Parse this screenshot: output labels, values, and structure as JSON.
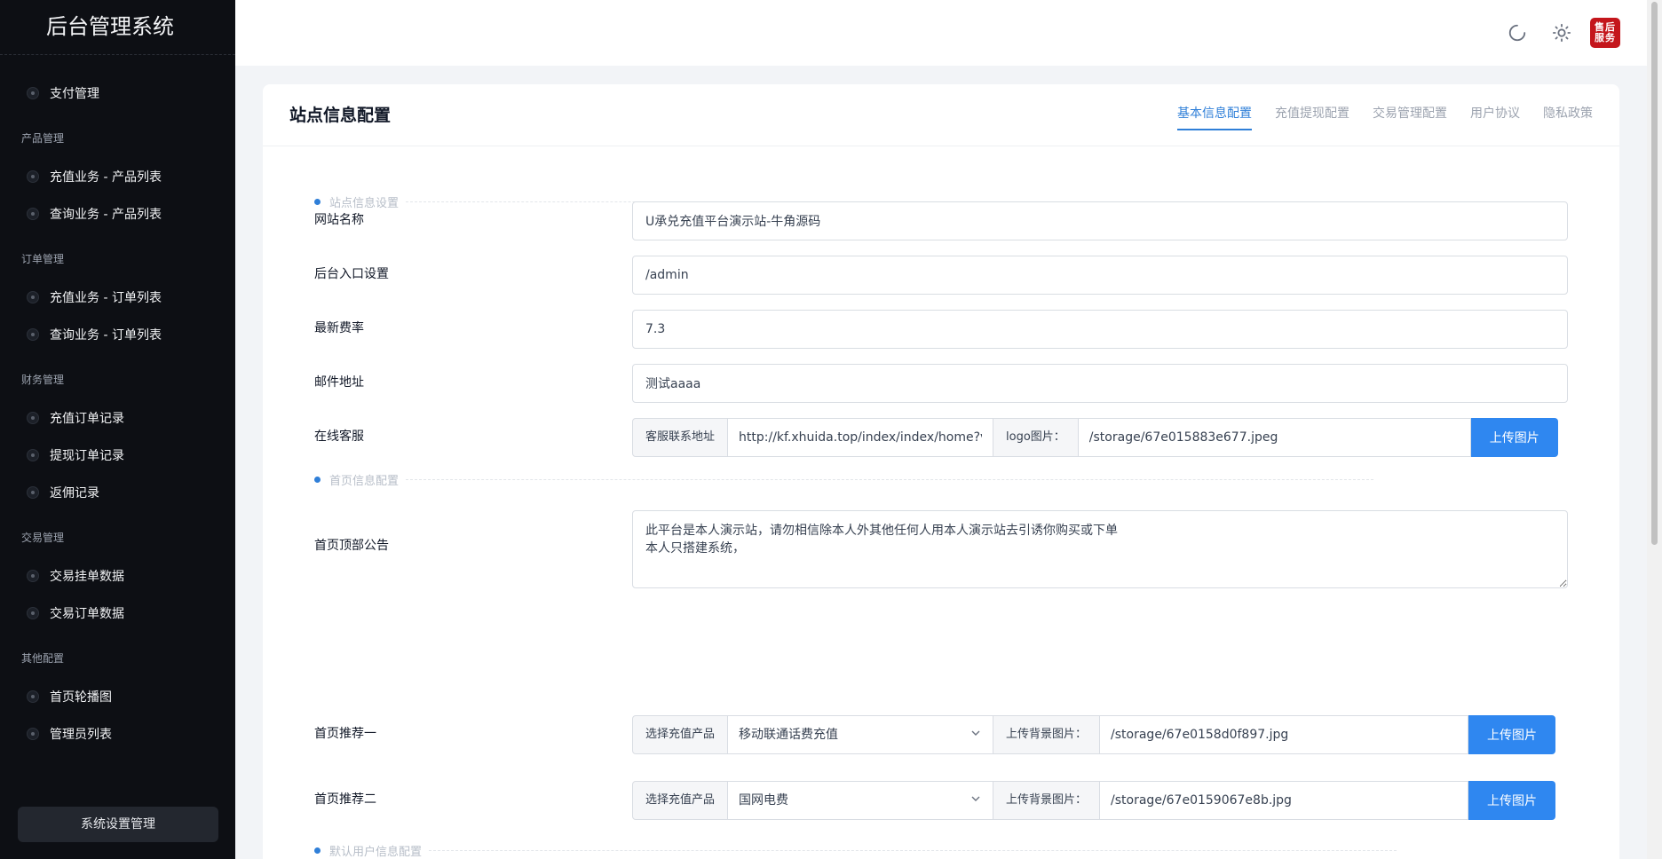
{
  "sidebar": {
    "brand": "后台管理系统",
    "items_top": [
      {
        "label": "支付管理"
      }
    ],
    "groups": [
      {
        "title": "产品管理",
        "items": [
          {
            "label": "充值业务 - 产品列表"
          },
          {
            "label": "查询业务 - 产品列表"
          }
        ]
      },
      {
        "title": "订单管理",
        "items": [
          {
            "label": "充值业务 - 订单列表"
          },
          {
            "label": "查询业务 - 订单列表"
          }
        ]
      },
      {
        "title": "财务管理",
        "items": [
          {
            "label": "充值订单记录"
          },
          {
            "label": "提现订单记录"
          },
          {
            "label": "返佣记录"
          }
        ]
      },
      {
        "title": "交易管理",
        "items": [
          {
            "label": "交易挂单数据"
          },
          {
            "label": "交易订单数据"
          }
        ]
      },
      {
        "title": "其他配置",
        "items": [
          {
            "label": "首页轮播图"
          },
          {
            "label": "管理员列表"
          }
        ]
      }
    ],
    "system_button": "系统设置管理"
  },
  "header": {
    "support_badge": "售后服务",
    "icons": [
      "refresh-icon",
      "sun-icon"
    ]
  },
  "card": {
    "title": "站点信息配置",
    "tabs": [
      {
        "label": "基本信息配置",
        "active": true
      },
      {
        "label": "充值提现配置",
        "active": false
      },
      {
        "label": "交易管理配置",
        "active": false
      },
      {
        "label": "用户协议",
        "active": false
      },
      {
        "label": "隐私政策",
        "active": false
      }
    ]
  },
  "sections": {
    "site": "站点信息设置",
    "home": "首页信息配置",
    "default_user": "默认用户信息配置"
  },
  "form": {
    "site_name": {
      "label": "网站名称",
      "value": "U承兑充值平台演示站-牛角源码"
    },
    "admin_entry": {
      "label": "后台入口设置",
      "value": "/admin"
    },
    "rate": {
      "label": "最新费率",
      "value": "7.3"
    },
    "email": {
      "label": "邮件地址",
      "value": "测试aaaa"
    },
    "online_service": {
      "label": "在线客服",
      "contact_addon": "客服联系地址",
      "contact_value": "http://kf.xhuida.top/index/index/home?v",
      "logo_addon": "logo图片：",
      "logo_value": "/storage/67e015883e677.jpeg",
      "upload_label": "上传图片"
    },
    "notice": {
      "label": "首页顶部公告",
      "value": "此平台是本人演示站，请勿相信除本人外其他任何人用本人演示站去引诱你购买或下单\n本人只搭建系统，"
    },
    "recommend1": {
      "label": "首页推荐一",
      "product_addon": "选择充值产品",
      "product_value": "移动联通话费充值",
      "bg_addon": "上传背景图片：",
      "bg_value": "/storage/67e0158d0f897.jpg",
      "upload_label": "上传图片"
    },
    "recommend2": {
      "label": "首页推荐二",
      "product_addon": "选择充值产品",
      "product_value": "国网电费",
      "bg_addon": "上传背景图片：",
      "bg_value": "/storage/67e0159067e8b.jpg",
      "upload_label": "上传图片"
    }
  },
  "colors": {
    "accent": "#2f87f0",
    "sidebar_bg": "#0d0f14",
    "badge": "#c4161c"
  }
}
